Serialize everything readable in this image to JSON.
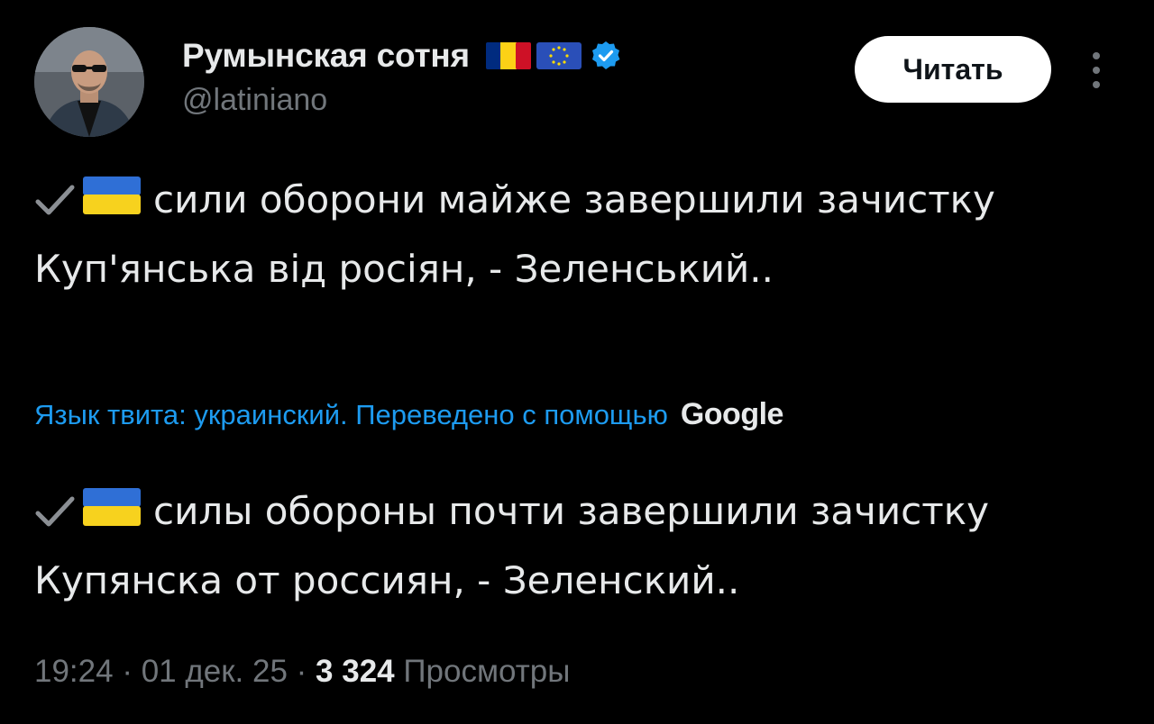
{
  "author": {
    "display_name": "Румынская сотня",
    "handle": "@latiniano",
    "flags": [
      "romania-flag-icon",
      "eu-flag-icon"
    ],
    "verified_icon": "verified-badge-icon"
  },
  "header": {
    "follow_label": "Читать",
    "more_icon": "more-vertical-icon"
  },
  "tweet": {
    "original_prefix_icons": [
      "checkmark-icon",
      "ukraine-flag-icon"
    ],
    "original_text": "сили оборони майже завершили зачистку Куп'янська від росіян, - Зеленський..",
    "translation_note": "Язык твита: украинский. Переведено с помощью",
    "translation_provider": "Google",
    "translated_text": "силы обороны почти завершили зачистку Купянска от россиян, - Зеленский.."
  },
  "meta": {
    "time": "19:24",
    "separator": " · ",
    "date": "01 дек. 25",
    "views_count": "3 324",
    "views_label": "Просмотры"
  },
  "colors": {
    "background": "#000000",
    "primary_text": "#e7e9ea",
    "secondary_text": "#71767b",
    "link": "#1d9bf0",
    "verified": "#1d9bf0",
    "follow_button_bg": "#ffffff"
  }
}
